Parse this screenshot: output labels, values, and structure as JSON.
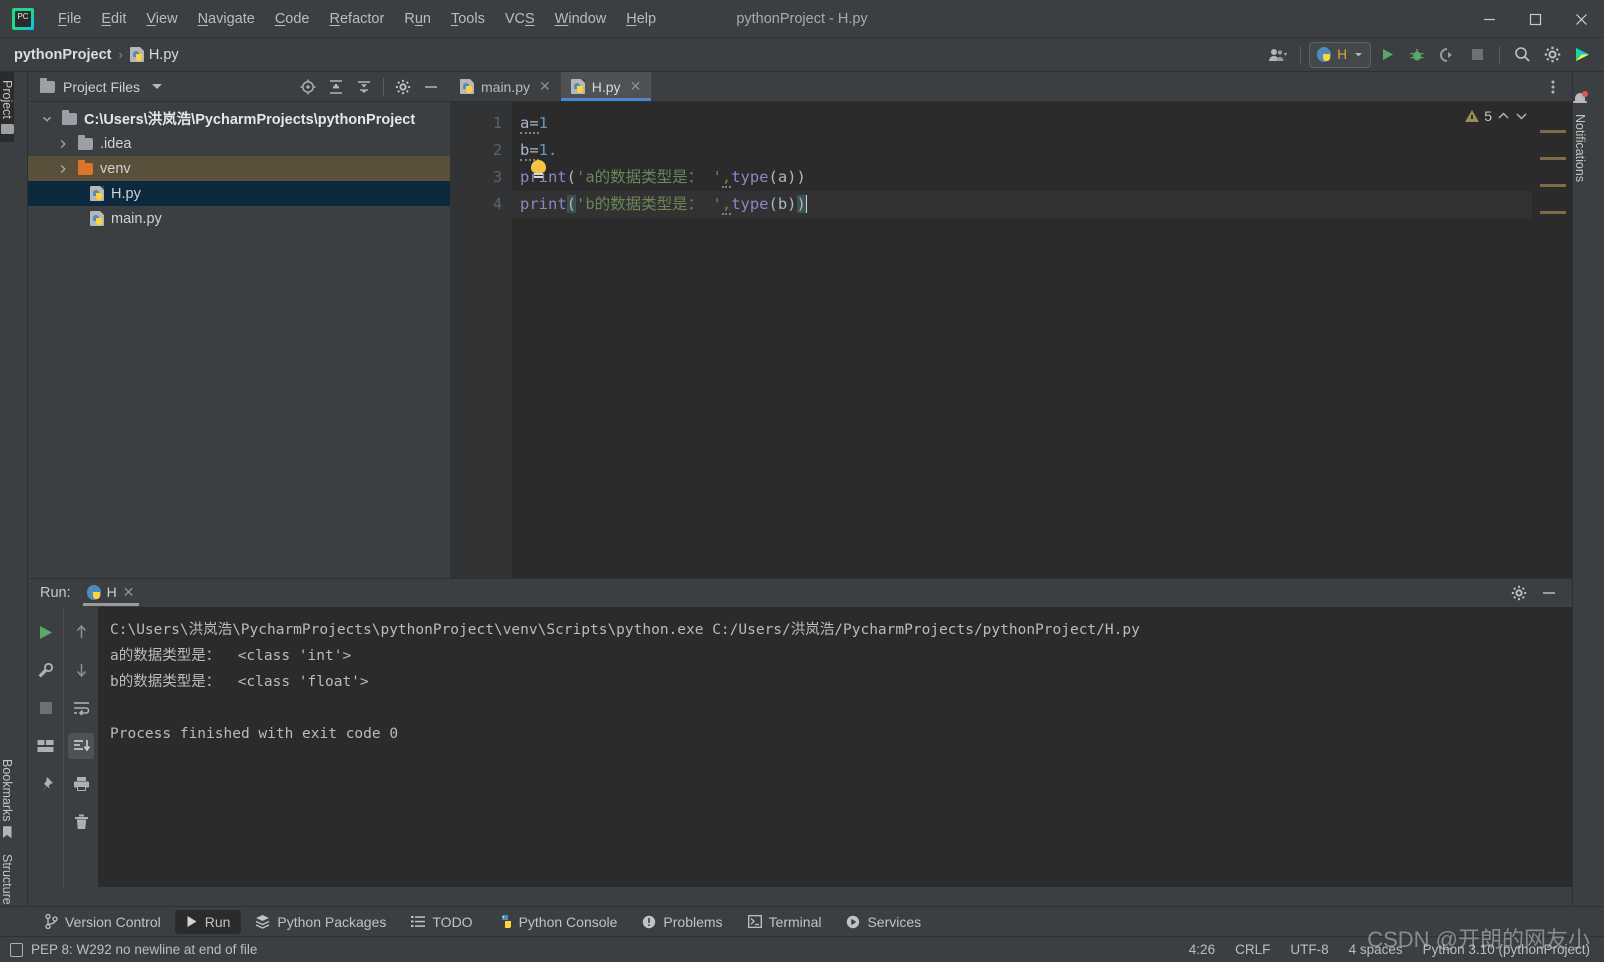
{
  "window": {
    "title": "pythonProject - H.py",
    "controls": {
      "minimize": "─",
      "maximize": "□",
      "close": "✕"
    }
  },
  "menu": [
    {
      "label": "File",
      "mnemonic": "F"
    },
    {
      "label": "Edit",
      "mnemonic": "E"
    },
    {
      "label": "View",
      "mnemonic": "V"
    },
    {
      "label": "Navigate",
      "mnemonic": "N"
    },
    {
      "label": "Code",
      "mnemonic": "C"
    },
    {
      "label": "Refactor",
      "mnemonic": "R"
    },
    {
      "label": "Run",
      "mnemonic": "u"
    },
    {
      "label": "Tools",
      "mnemonic": "T"
    },
    {
      "label": "VCS",
      "mnemonic": "S"
    },
    {
      "label": "Window",
      "mnemonic": "W"
    },
    {
      "label": "Help",
      "mnemonic": "H"
    }
  ],
  "navbar": {
    "breadcrumb_project": "pythonProject",
    "breadcrumb_sep": "›",
    "breadcrumb_file": "H.py",
    "run_config": "H",
    "icons": [
      "account-icon",
      "run-icon",
      "debug-icon",
      "run-coverage-icon",
      "stop-icon",
      "search-everywhere-icon",
      "settings-icon",
      "ide-assistant-icon"
    ]
  },
  "rails": {
    "left_top": "Project",
    "left_bottom": [
      "Bookmarks",
      "Structure"
    ],
    "right": "Notifications"
  },
  "project_panel": {
    "title": "Project Files",
    "toolbar_icons": [
      "locate-icon",
      "expand-all-icon",
      "collapse-all-icon",
      "settings-icon",
      "hide-icon"
    ],
    "tree": [
      {
        "name": "C:\\Users\\洪岚浩\\PycharmProjects\\pythonProject",
        "indent": 0,
        "arrow": "⌄",
        "icon": "folder",
        "bold": true,
        "state": "normal"
      },
      {
        "name": ".idea",
        "indent": 1,
        "arrow": "›",
        "icon": "folder",
        "bold": false,
        "state": "normal"
      },
      {
        "name": "venv",
        "indent": 1,
        "arrow": "›",
        "icon": "folder-orange",
        "bold": false,
        "state": "highlighted"
      },
      {
        "name": "H.py",
        "indent": 2,
        "arrow": "",
        "icon": "python",
        "bold": false,
        "state": "selected"
      },
      {
        "name": "main.py",
        "indent": 2,
        "arrow": "",
        "icon": "python",
        "bold": false,
        "state": "normal"
      }
    ]
  },
  "editor": {
    "tabs": [
      {
        "label": "main.py",
        "icon": "python",
        "active": false,
        "close": "✕"
      },
      {
        "label": "H.py",
        "icon": "python",
        "active": true,
        "close": "✕"
      }
    ],
    "line_numbers": [
      "1",
      "2",
      "3",
      "4"
    ],
    "lines": [
      {
        "n": "1",
        "parts": [
          {
            "t": "a=",
            "c": "fn"
          },
          {
            "t": "1",
            "c": "num"
          }
        ]
      },
      {
        "n": "2",
        "parts": [
          {
            "t": "b=",
            "c": "fn"
          },
          {
            "t": "1.",
            "c": "num"
          }
        ]
      },
      {
        "n": "3",
        "parts": [
          {
            "t": "print",
            "c": "kw"
          },
          {
            "t": "(",
            "c": "paren"
          },
          {
            "t": "'a的数据类型是： '",
            "c": "str"
          },
          {
            "t": ",",
            "c": "paren"
          },
          {
            "t": "type",
            "c": "kw"
          },
          {
            "t": "(a))",
            "c": "paren"
          }
        ]
      },
      {
        "n": "4",
        "parts": [
          {
            "t": "print",
            "c": "kw"
          },
          {
            "t": "(",
            "c": "paren"
          },
          {
            "t": "'b的数据类型是： '",
            "c": "str"
          },
          {
            "t": ",",
            "c": "paren"
          },
          {
            "t": "type",
            "c": "kw"
          },
          {
            "t": "(b))",
            "c": "paren"
          }
        ]
      }
    ],
    "warning_count": "5",
    "warning_icon": "warning-triangle-icon"
  },
  "run_panel": {
    "label": "Run:",
    "tab": "H",
    "tab_close": "✕",
    "left_tool_icons": [
      "rerun-icon",
      "wrench-icon",
      "stop-icon",
      "layout-icon",
      "pin-icon"
    ],
    "right_tool_icons": [
      "up-icon",
      "down-icon",
      "soft-wrap-icon",
      "scroll-to-end-icon",
      "print-icon",
      "trash-icon"
    ],
    "head_right_icons": [
      "settings-icon",
      "hide-icon"
    ],
    "console": [
      "C:\\Users\\洪岚浩\\PycharmProjects\\pythonProject\\venv\\Scripts\\python.exe C:/Users/洪岚浩/PycharmProjects/pythonProject/H.py",
      "a的数据类型是：  <class 'int'>",
      "b的数据类型是：  <class 'float'>",
      "",
      "Process finished with exit code 0"
    ]
  },
  "tools_bar": [
    {
      "label": "Version Control",
      "icon": "branch-icon",
      "active": false
    },
    {
      "label": "Run",
      "icon": "play-icon",
      "active": true
    },
    {
      "label": "Python Packages",
      "icon": "packages-icon",
      "active": false
    },
    {
      "label": "TODO",
      "icon": "todo-icon",
      "active": false
    },
    {
      "label": "Python Console",
      "icon": "python-console-icon",
      "active": false
    },
    {
      "label": "Problems",
      "icon": "problems-icon",
      "active": false
    },
    {
      "label": "Terminal",
      "icon": "terminal-icon",
      "active": false
    },
    {
      "label": "Services",
      "icon": "services-icon",
      "active": false
    }
  ],
  "status_bar": {
    "inspection_icon": "inspection-icon",
    "message": "PEP 8: W292 no newline at end of file",
    "caret_position": "4:26",
    "line_separator": "CRLF",
    "encoding": "UTF-8",
    "indent": "4 spaces",
    "interpreter": "Python 3.10 (pythonProject)"
  },
  "watermark": "CSDN @开朗的网友小"
}
